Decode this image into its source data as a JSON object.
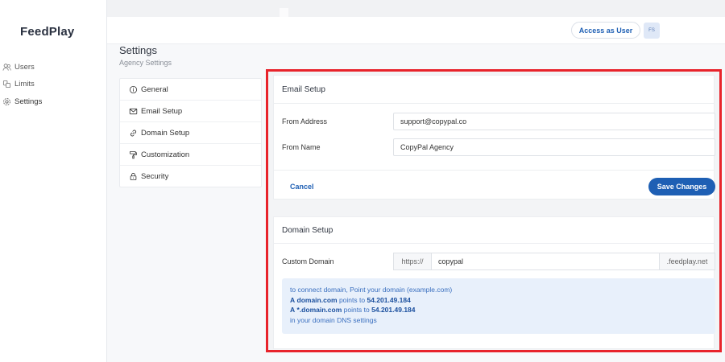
{
  "app": {
    "logo": "FeedPlay"
  },
  "sidebar": {
    "items": [
      {
        "label": "Users",
        "icon": "users-icon"
      },
      {
        "label": "Limits",
        "icon": "limits-icon"
      },
      {
        "label": "Settings",
        "icon": "gear-icon",
        "active": true
      }
    ]
  },
  "header": {
    "access_label": "Access as User",
    "avatar_initials": "FS"
  },
  "page": {
    "title": "Settings",
    "subtitle": "Agency Settings"
  },
  "settings_menu": {
    "items": [
      {
        "label": "General",
        "icon": "info-circle-icon"
      },
      {
        "label": "Email Setup",
        "icon": "mail-icon"
      },
      {
        "label": "Domain Setup",
        "icon": "link-icon"
      },
      {
        "label": "Customization",
        "icon": "paint-roller-icon"
      },
      {
        "label": "Security",
        "icon": "lock-icon"
      }
    ]
  },
  "email_setup": {
    "title": "Email Setup",
    "from_address_label": "From Address",
    "from_address_value": "support@copypal.co",
    "from_name_label": "From Name",
    "from_name_value": "CopyPal Agency",
    "cancel_label": "Cancel",
    "save_label": "Save Changes"
  },
  "domain_setup": {
    "title": "Domain Setup",
    "custom_domain_label": "Custom Domain",
    "prefix": "https://",
    "value": "copypal",
    "suffix": ".feedplay.net",
    "info": {
      "line1": "to connect domain, Point your domain (example.com)",
      "line2_prefix": "A",
      "line2_domain": "domain.com",
      "line2_mid": "points to",
      "line2_ip": "54.201.49.184",
      "line3_prefix": "A",
      "line3_domain": "*.domain.com",
      "line3_mid": "points to",
      "line3_ip": "54.201.49.184",
      "line4": "in your domain DNS settings"
    }
  },
  "colors": {
    "accent": "#1e5fb4",
    "highlight_border": "#e8232b",
    "info_bg": "#e8f0fb"
  }
}
